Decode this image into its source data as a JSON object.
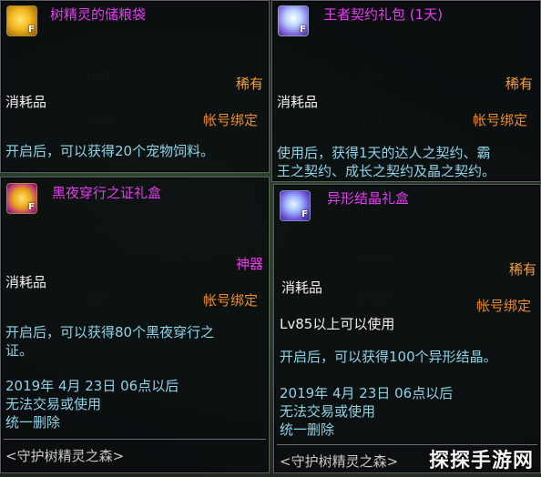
{
  "background_ghost": [
    "160",
    "160",
    "1",
    "225",
    "200",
    "150",
    "1250",
    "1500"
  ],
  "tooltips": [
    {
      "icon": "pet-food-bag-icon",
      "icon_tag": "F",
      "title": "树精灵的储粮袋",
      "rarity": "稀有",
      "rarity_color": "#f0a040",
      "type": "消耗品",
      "bind": "帐号绑定",
      "desc_lines": [
        "开启后，可以获得20个宠物饲料。"
      ]
    },
    {
      "icon": "contract-gift-pack-icon",
      "icon_tag": "F",
      "title": "王者契约礼包 (1天)",
      "rarity": "稀有",
      "rarity_color": "#f0a040",
      "type": "消耗品",
      "bind": "帐号绑定",
      "desc_lines": [
        "使用后，获得1天的达人之契约、霸",
        "王之契约、成长之契约及晶之契约。"
      ]
    },
    {
      "icon": "night-certificate-gift-box-icon",
      "icon_tag": "F",
      "title": "黑夜穿行之证礼盒",
      "rarity": "神器",
      "rarity_color": "#e040e0",
      "type": "消耗品",
      "bind": "帐号绑定",
      "desc_lines": [
        "开启后，可以获得80个黑夜穿行之",
        "证。"
      ],
      "expiry": "2019年 4月 23日 06点以后",
      "trade_note": "无法交易或使用",
      "delete_note": "统一删除",
      "source": "<守护树精灵之森>"
    },
    {
      "icon": "alien-crystal-gift-box-icon",
      "icon_tag": "F",
      "title": "异形结晶礼盒",
      "rarity": "稀有",
      "rarity_color": "#f0a040",
      "type": "消耗品",
      "bind": "帐号绑定",
      "level_req": "Lv85以上可以使用",
      "desc_lines": [
        "开启后，可以获得100个异形结晶。"
      ],
      "expiry": "2019年 4月 23日 06点以后",
      "trade_note": "无法交易或使用",
      "delete_note": "统一删除",
      "source": "<守护树精灵之森>"
    }
  ],
  "watermark": "探探手游网"
}
